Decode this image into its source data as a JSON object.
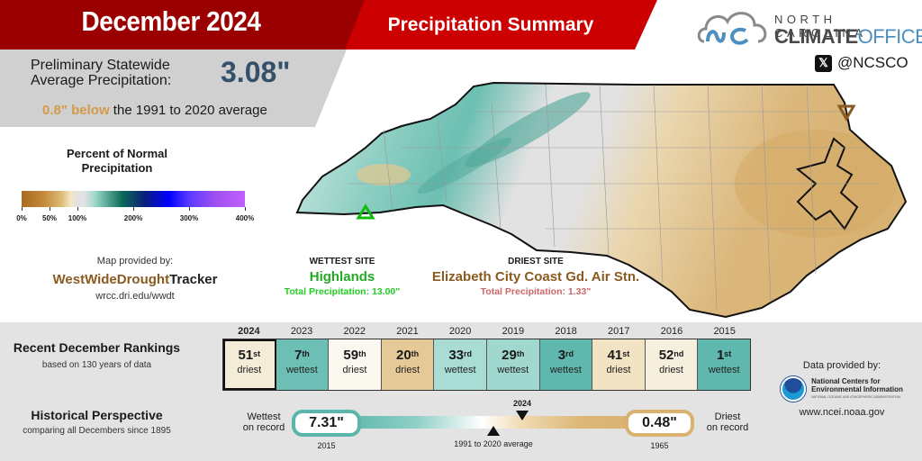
{
  "header": {
    "title": "December 2024",
    "subtitle": "Precipitation Summary"
  },
  "statewide": {
    "label_line1": "Preliminary Statewide",
    "label_line2": "Average Precipitation:",
    "value": "3.08\"",
    "departure": "0.8\" below",
    "comparison": " the 1991 to 2020 average"
  },
  "logo": {
    "line1": "NORTH CAROLINA",
    "line2_bold": "CLIMATE",
    "line2_light": "OFFICE",
    "social_icon": "x-icon",
    "social_handle": "@NCSCO"
  },
  "legend": {
    "title_line1": "Percent of Normal",
    "title_line2": "Precipitation",
    "ticks": [
      "0%",
      "50%",
      "100%",
      "200%",
      "300%",
      "400%"
    ],
    "tick_values": [
      0,
      50,
      100,
      200,
      300,
      400
    ]
  },
  "map_credit": {
    "label": "Map provided by:",
    "brand_part1": "WestWideDrought",
    "brand_part2": "Tracker",
    "url": "wrcc.dri.edu/wwdt"
  },
  "wettest_site": {
    "heading": "WETTEST SITE",
    "name": "Highlands",
    "total": "Total Precipitation: 13.00\"",
    "marker_icon": "triangle-up-icon",
    "color": "#22aa22"
  },
  "driest_site": {
    "heading": "DRIEST SITE",
    "name": "Elizabeth City Coast Gd. Air Stn.",
    "total": "Total Precipitation: 1.33\"",
    "marker_icon": "triangle-down-icon",
    "color": "#8a5a20"
  },
  "rankings": {
    "title": "Recent December Rankings",
    "subtitle": "based on 130 years of data",
    "items": [
      {
        "year": "2024",
        "rank": "51",
        "suffix": "st",
        "type": "driest",
        "color": "#f5ecd8",
        "current": true
      },
      {
        "year": "2023",
        "rank": "7",
        "suffix": "th",
        "type": "wettest",
        "color": "#6dbfb5",
        "current": false
      },
      {
        "year": "2022",
        "rank": "59",
        "suffix": "th",
        "type": "driest",
        "color": "#fbf8f0",
        "current": false
      },
      {
        "year": "2021",
        "rank": "20",
        "suffix": "th",
        "type": "driest",
        "color": "#e5c997",
        "current": false
      },
      {
        "year": "2020",
        "rank": "33",
        "suffix": "rd",
        "type": "wettest",
        "color": "#a8dcd4",
        "current": false
      },
      {
        "year": "2019",
        "rank": "29",
        "suffix": "th",
        "type": "wettest",
        "color": "#a0d8cf",
        "current": false
      },
      {
        "year": "2018",
        "rank": "3",
        "suffix": "rd",
        "type": "wettest",
        "color": "#5fb7ad",
        "current": false
      },
      {
        "year": "2017",
        "rank": "41",
        "suffix": "st",
        "type": "driest",
        "color": "#f1e3c3",
        "current": false
      },
      {
        "year": "2016",
        "rank": "52",
        "suffix": "nd",
        "type": "driest",
        "color": "#f7efdd",
        "current": false
      },
      {
        "year": "2015",
        "rank": "1",
        "suffix": "st",
        "type": "wettest",
        "color": "#5fb7ad",
        "current": false
      }
    ]
  },
  "data_credit": {
    "label": "Data provided by:",
    "org_line1": "National Centers for",
    "org_line2": "Environmental Information",
    "org_sub": "NATIONAL OCEANIC AND ATMOSPHERIC ADMINISTRATION",
    "url": "www.ncei.noaa.gov"
  },
  "historical": {
    "title": "Historical Perspective",
    "subtitle": "comparing all Decembers since 1895",
    "wettest_label_line1": "Wettest",
    "wettest_label_line2": "on record",
    "wettest_value": "7.31\"",
    "wettest_year": "2015",
    "driest_label_line1": "Driest",
    "driest_label_line2": "on record",
    "driest_value": "0.48\"",
    "driest_year": "1965",
    "average_label": "1991 to 2020 average",
    "current_label": "2024"
  }
}
